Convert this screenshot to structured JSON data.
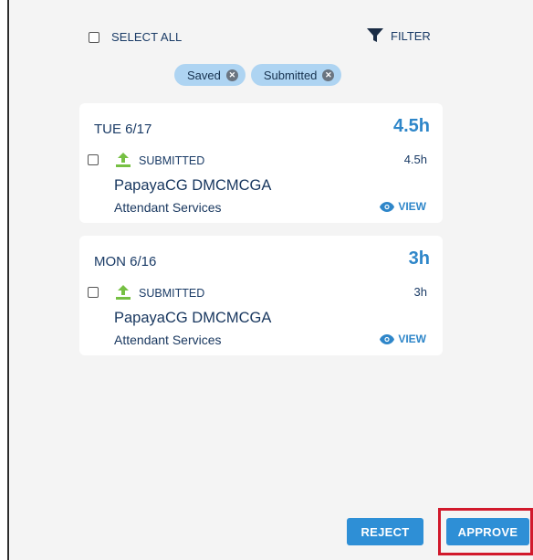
{
  "toolbar": {
    "select_all_label": "SELECT ALL",
    "filter_label": "FILTER"
  },
  "chips": [
    {
      "label": "Saved"
    },
    {
      "label": "Submitted"
    }
  ],
  "entries": [
    {
      "date": "TUE 6/17",
      "total": "4.5h",
      "status": "SUBMITTED",
      "hours": "4.5h",
      "client": "PapayaCG DMCMCGA",
      "service": "Attendant Services",
      "view_label": "VIEW"
    },
    {
      "date": "MON 6/16",
      "total": "3h",
      "status": "SUBMITTED",
      "hours": "3h",
      "client": "PapayaCG DMCMCGA",
      "service": "Attendant Services",
      "view_label": "VIEW"
    }
  ],
  "actions": {
    "reject_label": "REJECT",
    "approve_label": "APPROVE"
  },
  "colors": {
    "accent": "#2e8fd6",
    "chip_bg": "#aed4f2",
    "submitted_icon": "#76c043",
    "highlight": "#d1192c"
  },
  "icons": {
    "filter": "filter-icon",
    "chip_remove": "close-circle-icon",
    "status": "upload-icon",
    "view": "eye-icon"
  }
}
